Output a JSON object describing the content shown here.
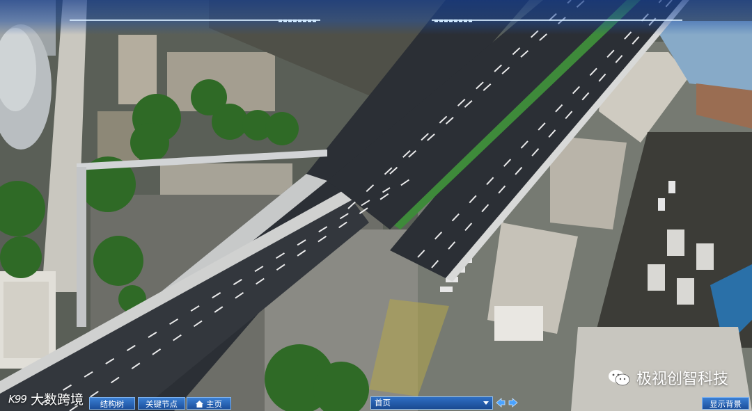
{
  "watermark": {
    "icon": "wechat-icon",
    "text": "极视创智科技"
  },
  "brand": {
    "logo": "K99",
    "text": "大数跨境"
  },
  "toolbar": {
    "structure_tree": "结构树",
    "key_nodes": "关键节点",
    "home": "主页",
    "home_icon": "home-icon"
  },
  "view_select": {
    "selected": "首页"
  },
  "nav": {
    "prev_icon": "arrow-left-icon",
    "next_icon": "arrow-right-icon"
  },
  "show_background": "显示背景",
  "colors": {
    "hud_blue": "#1c4f9c",
    "hud_border": "#7fb3ee",
    "road": "#2a2f35",
    "green_median": "#3e8a3a"
  }
}
